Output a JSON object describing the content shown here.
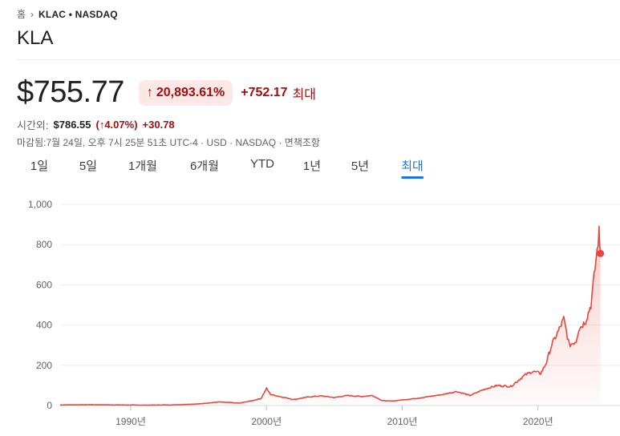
{
  "breadcrumb": {
    "home": "홈",
    "ticker": "KLAC • NASDAQ"
  },
  "company": {
    "name": "KLA"
  },
  "quote": {
    "price": "$755.77",
    "change_pct": "20,893.61%",
    "change_abs": "+752.17",
    "period_label": "최대"
  },
  "after_hours": {
    "label": "시간외:",
    "price": "$786.55",
    "pct": "(↑4.07%)",
    "abs": "+30.78"
  },
  "meta": "마감됨:7월 24일, 오후 7시 25분 51초 UTC-4 · USD · NASDAQ · 면책조항",
  "tabs": [
    {
      "label": "1일"
    },
    {
      "label": "5일"
    },
    {
      "label": "1개월"
    },
    {
      "label": "6개월"
    },
    {
      "label": "YTD"
    },
    {
      "label": "1년"
    },
    {
      "label": "5년"
    },
    {
      "label": "최대",
      "active": true
    }
  ],
  "colors": {
    "line": "#e8453c",
    "up_bg": "#fce8e6",
    "up_text": "#a50e0e",
    "accent": "#1a73e8"
  },
  "chart_data": {
    "type": "area",
    "ylim": [
      0,
      1000
    ],
    "y_ticks": [
      0,
      200,
      400,
      600,
      800,
      1000
    ],
    "y_tick_labels": [
      "0",
      "200",
      "400",
      "600",
      "800",
      "1,000"
    ],
    "x_ticks": [
      1990,
      2000,
      2010,
      2020
    ],
    "x_tick_labels": [
      "1990년",
      "2000년",
      "2010년",
      "2020년"
    ],
    "xlim": [
      1984.8,
      2024.8
    ],
    "x": [
      1984.8,
      1987,
      1989,
      1991,
      1993,
      1995,
      1996.5,
      1998,
      1999,
      1999.6,
      2000,
      2000.3,
      2001,
      2002,
      2003,
      2004,
      2005,
      2006,
      2007,
      2007.8,
      2008.5,
      2009.2,
      2010,
      2011,
      2012,
      2013,
      2014,
      2015,
      2016,
      2017,
      2018,
      2019,
      2019.6,
      2020.2,
      2020.6,
      2021,
      2021.5,
      2021.9,
      2022.3,
      2022.8,
      2023,
      2023.5,
      2023.9,
      2024.2,
      2024.5,
      2024.6
    ],
    "values": [
      3,
      4,
      3,
      2,
      3,
      8,
      18,
      12,
      25,
      35,
      85,
      55,
      45,
      30,
      42,
      48,
      40,
      50,
      45,
      50,
      25,
      22,
      28,
      35,
      45,
      55,
      70,
      50,
      80,
      100,
      95,
      150,
      170,
      160,
      210,
      300,
      370,
      430,
      300,
      320,
      380,
      420,
      500,
      680,
      860,
      755.77
    ],
    "last_value": 755.77
  }
}
